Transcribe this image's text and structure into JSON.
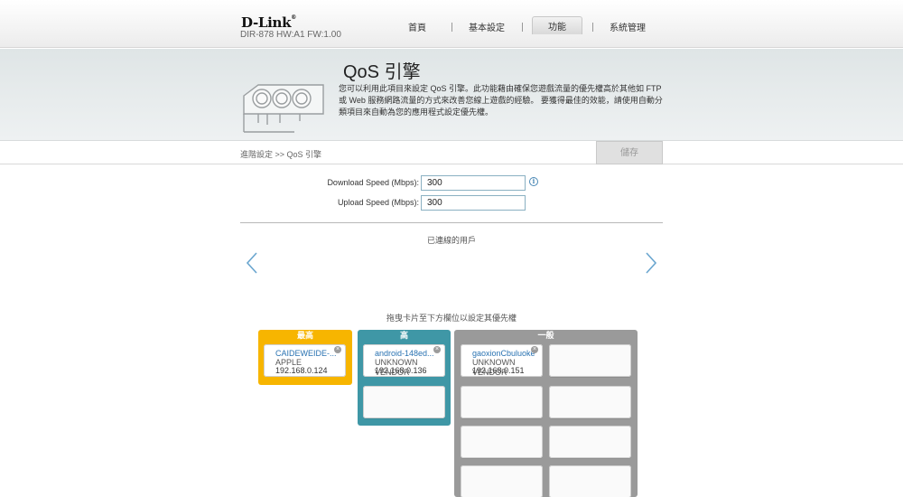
{
  "brand": {
    "logo": "D-Link",
    "model": "DIR-878 HW:A1 FW:1.00"
  },
  "nav": {
    "items": [
      {
        "label": "首頁"
      },
      {
        "label": "基本設定"
      },
      {
        "label": "功能"
      },
      {
        "label": "系統管理"
      }
    ],
    "active": "功能"
  },
  "banner": {
    "title": "QoS 引擎",
    "description": "您可以利用此項目來設定 QoS 引擎。此功能藉由確保您遊戲流量的優先權高於其他如 FTP 或 Web 服務網路流量的方式來改善您線上遊戲的經驗。 要獲得最佳的效能，請使用自動分類項目來自動為您的應用程式設定優先權。"
  },
  "breadcrumb": "進階設定 >> QoS 引擎",
  "save_label": "儲存",
  "speeds": {
    "download_label": "Download Speed (Mbps):",
    "download_value": "300",
    "upload_label": "Upload Speed (Mbps):",
    "upload_value": "300"
  },
  "connected_title": "已連線的用戶",
  "drag_hint": "拖曳卡片至下方欄位以設定其優先權",
  "columns": {
    "highest": {
      "label": "最高",
      "cards": [
        {
          "name": "CAIDEWEIDE-...",
          "vendor": "APPLE",
          "ip": "192.168.0.124"
        }
      ]
    },
    "high": {
      "label": "高",
      "cards": [
        {
          "name": "android-148ed...",
          "vendor": "UNKNOWN",
          "ip": "192.168.0.136",
          "ghost": "VENDOR"
        }
      ]
    },
    "normal": {
      "label": "一般",
      "cards": [
        {
          "name": "gaoxionCbuluoke",
          "vendor": "UNKNOWN",
          "ip": "192.168.0.151",
          "ghost": "VENDOR"
        }
      ]
    }
  },
  "colors": {
    "highest": "#f7b500",
    "high": "#3f97a6",
    "normal": "#9a9a9a",
    "link": "#2a73b2"
  }
}
